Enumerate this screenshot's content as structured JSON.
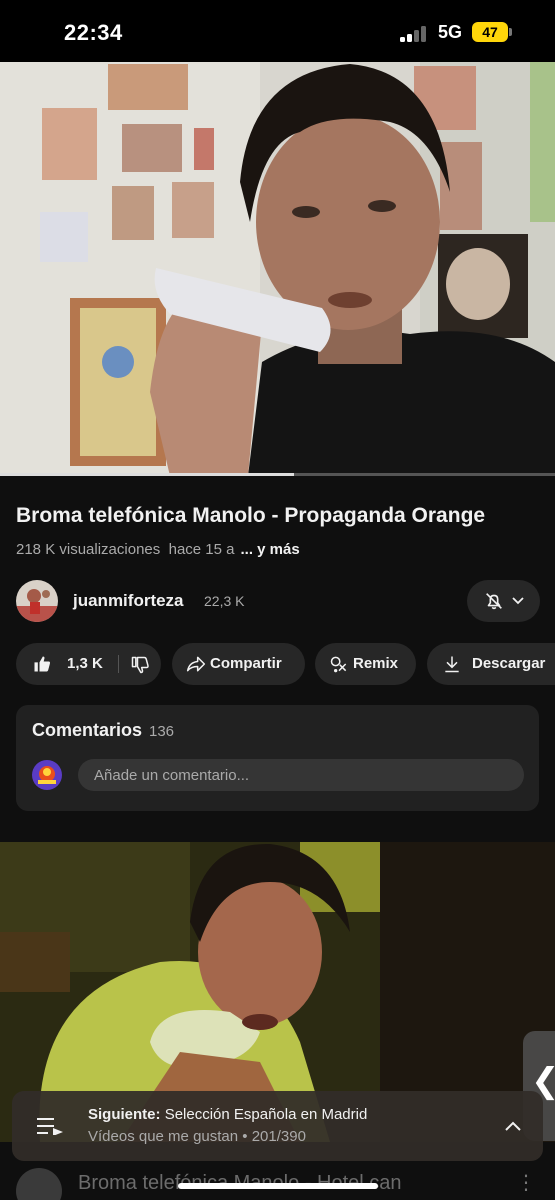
{
  "status_bar": {
    "time": "22:34",
    "network": "5G",
    "battery": "47",
    "icons": [
      "signal-icon",
      "battery-icon"
    ]
  },
  "player": {
    "progress_fraction": 0.53
  },
  "video": {
    "title": "Broma telefónica Manolo - Propaganda Orange",
    "views": "218 K visualizaciones",
    "age": "hace 15 a",
    "more_label": "... y más"
  },
  "channel": {
    "name": "juanmiforteza",
    "subscribers": "22,3 K",
    "bell_icon": "bell-off-icon"
  },
  "actions": {
    "likes": "1,3 K",
    "share": "Compartir",
    "remix": "Remix",
    "download": "Descargar"
  },
  "comments": {
    "title": "Comentarios",
    "count": "136",
    "placeholder": "Añade un comentario..."
  },
  "playlist": {
    "next_prefix": "Siguiente:",
    "next_title": "Selección Española en Madrid",
    "playlist_name": "Vídeos que me gustan",
    "position": "201/390"
  },
  "next_row": {
    "title": "Broma telefónica Manolo - Hotel can"
  },
  "colors": {
    "background": "#0f0f0f",
    "pill": "#272727",
    "card": "#212121",
    "battery": "#ffd60a",
    "secondary_text": "#aaaaaa"
  }
}
